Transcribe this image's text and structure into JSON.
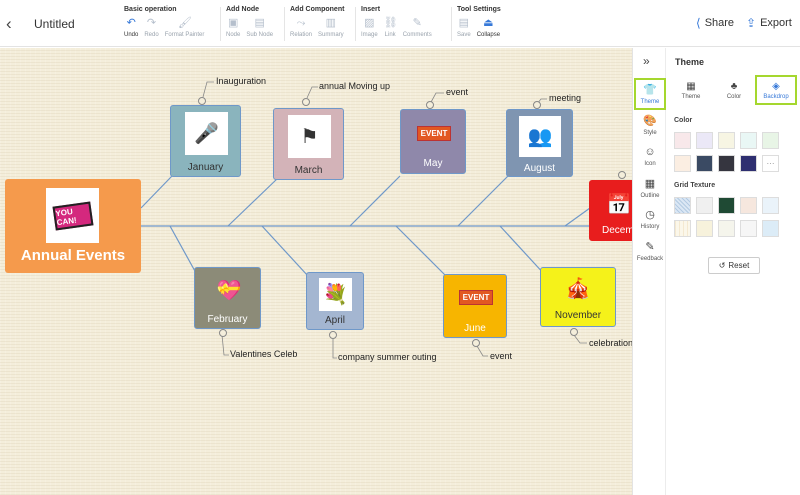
{
  "header": {
    "title": "Untitled",
    "groups": [
      {
        "title": "Basic operation",
        "tools": [
          {
            "label": "Undo",
            "icon": "undo-icon",
            "glyph": "↶",
            "active": true
          },
          {
            "label": "Redo",
            "icon": "redo-icon",
            "glyph": "↷",
            "active": false
          },
          {
            "label": "Format Painter",
            "icon": "format-painter-icon",
            "glyph": "🖌",
            "active": false
          }
        ]
      },
      {
        "title": "Add Node",
        "tools": [
          {
            "label": "Node",
            "icon": "node-icon",
            "glyph": "▣",
            "active": false
          },
          {
            "label": "Sub Node",
            "icon": "sub-node-icon",
            "glyph": "▤",
            "active": false
          }
        ]
      },
      {
        "title": "Add Component",
        "tools": [
          {
            "label": "Relation",
            "icon": "relation-icon",
            "glyph": "⤳",
            "active": false
          },
          {
            "label": "Summary",
            "icon": "summary-icon",
            "glyph": "▥",
            "active": false
          }
        ]
      },
      {
        "title": "Insert",
        "tools": [
          {
            "label": "Image",
            "icon": "image-icon",
            "glyph": "▨",
            "active": false
          },
          {
            "label": "Link",
            "icon": "link-icon",
            "glyph": "⛓",
            "active": false
          },
          {
            "label": "Comments",
            "icon": "comments-icon",
            "glyph": "✎",
            "active": false
          }
        ]
      },
      {
        "title": "Tool Settings",
        "tools": [
          {
            "label": "Save",
            "icon": "save-icon",
            "glyph": "▤",
            "active": false
          },
          {
            "label": "Collapse",
            "icon": "collapse-icon",
            "glyph": "⏏",
            "active": true
          }
        ]
      }
    ],
    "share_label": "Share",
    "export_label": "Export"
  },
  "mindmap": {
    "central": {
      "label": "Annual Events",
      "image_text": "YOU CAN!",
      "color": "#f59a4c"
    },
    "nodes": {
      "january": {
        "label": "January",
        "note": "Inauguration",
        "color": "#8ab4bd"
      },
      "march": {
        "label": "March",
        "note": "annual Moving up",
        "color": "#d3b3b8"
      },
      "may": {
        "label": "May",
        "note": "event",
        "color": "#8f88aa"
      },
      "august": {
        "label": "August",
        "note": "meeting",
        "color": "#7f95b1"
      },
      "december": {
        "label": "Decem",
        "color": "#e81d1d"
      },
      "february": {
        "label": "February",
        "note": "Valentines Celeb",
        "color": "#8c8b78"
      },
      "april": {
        "label": "April",
        "note": "company summer outing",
        "color": "#a4b6d1"
      },
      "june": {
        "label": "June",
        "note": "event",
        "color": "#f7b500"
      },
      "november": {
        "label": "November",
        "note": "celebration",
        "color": "#f5f21a"
      }
    },
    "event_badge": "EVENT"
  },
  "sidebar": {
    "items": [
      {
        "label": "Theme",
        "icon": "shirt-icon",
        "glyph": "👕",
        "active": true
      },
      {
        "label": "Style",
        "icon": "palette-icon",
        "glyph": "🎨",
        "active": false
      },
      {
        "label": "Icon",
        "icon": "smiley-icon",
        "glyph": "☺",
        "active": false
      },
      {
        "label": "Outline",
        "icon": "outline-icon",
        "glyph": "▦",
        "active": false
      },
      {
        "label": "History",
        "icon": "history-icon",
        "glyph": "◷",
        "active": false
      },
      {
        "label": "Feedback",
        "icon": "feedback-icon",
        "glyph": "✎",
        "active": false
      }
    ]
  },
  "panel": {
    "title": "Theme",
    "tabs": [
      {
        "label": "Theme",
        "icon": "grid-icon",
        "glyph": "▦",
        "active": false
      },
      {
        "label": "Color",
        "icon": "color-icon",
        "glyph": "♣",
        "active": false
      },
      {
        "label": "Backdrop",
        "icon": "paint-bucket-icon",
        "glyph": "◈",
        "active": true
      }
    ],
    "color_label": "Color",
    "colors": [
      "#f8e8ea",
      "#ebe8f7",
      "#f7f5e3",
      "#e9f7f5",
      "#e8f5e6",
      "#fbeee2",
      "#3a4a63",
      "#35353f",
      "#2e2f70"
    ],
    "texture_label": "Grid Texture",
    "textures": [
      "#dbe7f4",
      "#f0f0f0",
      "#1f4a34",
      "#f6e7de",
      "#eaf3fa",
      "#fbf7ea",
      "#f7f2dc",
      "#f5f5ec",
      "#f6f6f6",
      "#dcecf7"
    ],
    "reset_label": "Reset"
  }
}
